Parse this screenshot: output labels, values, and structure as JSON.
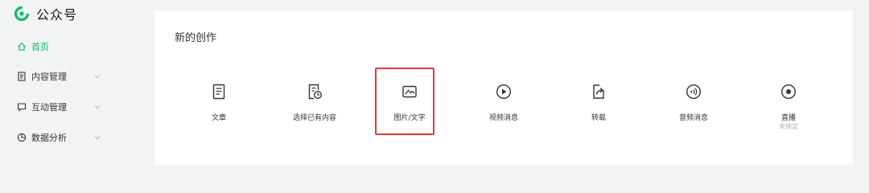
{
  "brand": {
    "name": "公众号",
    "logo_icon": "wechat-mp-logo-icon"
  },
  "colors": {
    "accent": "#07c160",
    "highlight": "#d93a3a",
    "text": "#333333",
    "muted": "#b2b2b2"
  },
  "sidebar": {
    "items": [
      {
        "label": "首页",
        "icon": "home-icon",
        "active": true
      },
      {
        "label": "内容管理",
        "icon": "document-icon",
        "expandable": true
      },
      {
        "label": "互动管理",
        "icon": "chat-icon",
        "expandable": true
      },
      {
        "label": "数据分析",
        "icon": "pie-chart-icon",
        "expandable": true
      }
    ]
  },
  "main": {
    "section_title": "新的创作",
    "tiles": [
      {
        "label": "文章",
        "icon": "article-icon"
      },
      {
        "label": "选择已有内容",
        "icon": "existing-content-icon"
      },
      {
        "label": "图片/文字",
        "icon": "image-text-icon",
        "highlighted": true
      },
      {
        "label": "视频消息",
        "icon": "video-play-icon"
      },
      {
        "label": "转载",
        "icon": "repost-icon"
      },
      {
        "label": "音频消息",
        "icon": "audio-icon"
      },
      {
        "label": "直播",
        "sub": "未绑定",
        "icon": "live-icon"
      }
    ]
  }
}
